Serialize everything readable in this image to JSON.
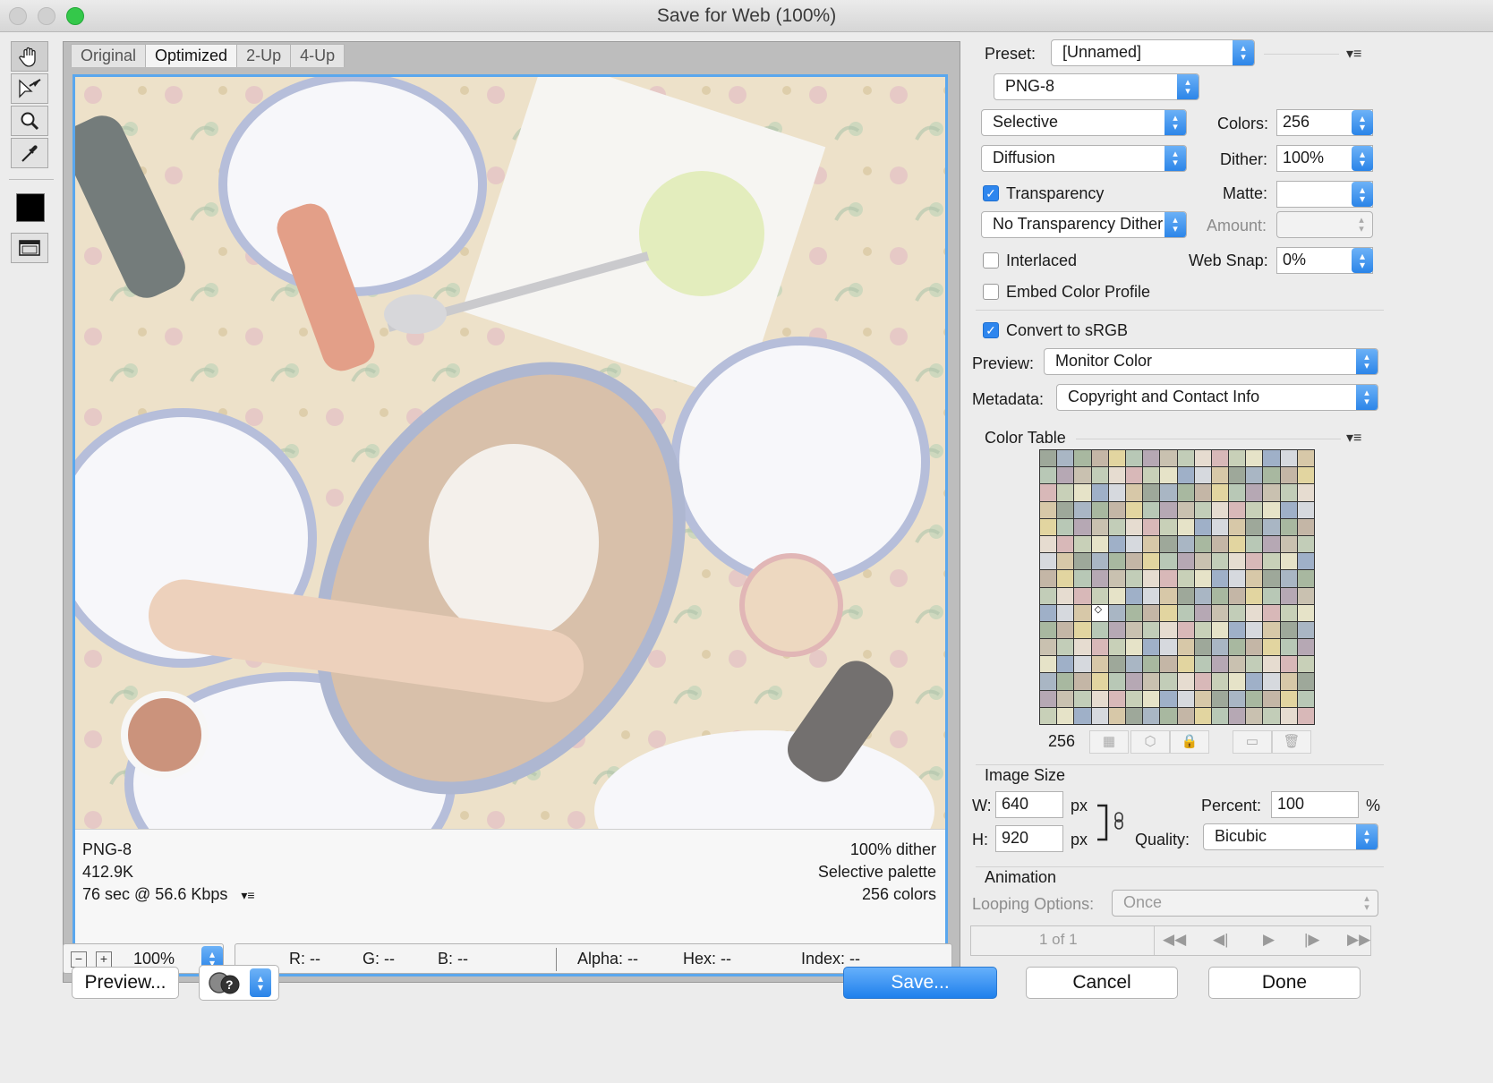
{
  "window": {
    "title": "Save for Web (100%)"
  },
  "tools": [
    {
      "name": "hand-tool",
      "glyph": "✋"
    },
    {
      "name": "slice-select-tool",
      "glyph": "⤡"
    },
    {
      "name": "zoom-tool",
      "glyph": "🔍"
    },
    {
      "name": "eyedropper-tool",
      "glyph": "✎"
    }
  ],
  "viewer": {
    "tabs": [
      "Original",
      "Optimized",
      "2-Up",
      "4-Up"
    ],
    "active_tab": "Optimized",
    "info_left": [
      "PNG-8",
      "412.9K",
      "76 sec @ 56.6 Kbps"
    ],
    "info_right": [
      "100% dither",
      "Selective palette",
      "256 colors"
    ],
    "info_menu_glyph": "▾≡"
  },
  "status": {
    "zoom": "100%",
    "r": "R: --",
    "g": "G: --",
    "b": "B: --",
    "alpha": "Alpha: --",
    "hex": "Hex: --",
    "index": "Index: --"
  },
  "buttons": {
    "preview": "Preview...",
    "save": "Save...",
    "cancel": "Cancel",
    "done": "Done"
  },
  "settings": {
    "preset_label": "Preset:",
    "preset_value": "[Unnamed]",
    "format": "PNG-8",
    "reduction": "Selective",
    "dither_algo": "Diffusion",
    "colors_label": "Colors:",
    "colors_value": "256",
    "dither_label": "Dither:",
    "dither_value": "100%",
    "transparency_label": "Transparency",
    "transparency_checked": true,
    "matte_label": "Matte:",
    "transparency_dither": "No Transparency Dither",
    "amount_label": "Amount:",
    "interlaced_label": "Interlaced",
    "interlaced_checked": false,
    "websnap_label": "Web Snap:",
    "websnap_value": "0%",
    "embed_label": "Embed Color Profile",
    "embed_checked": false,
    "srgb_label": "Convert to sRGB",
    "srgb_checked": true,
    "preview_label": "Preview:",
    "preview_value": "Monitor Color",
    "metadata_label": "Metadata:",
    "metadata_value": "Copyright and Contact Info"
  },
  "color_table": {
    "title": "Color Table",
    "count": "256",
    "palette": [
      "#9ea89a",
      "#c9c1b0",
      "#d6d9de",
      "#b8c8b6",
      "#e6e3c8",
      "#c4b6a6",
      "#d8b8b8",
      "#a9b6c4",
      "#c2cdb8",
      "#d7c8a8",
      "#b6a8b4",
      "#9fb0c8",
      "#e2d5a0",
      "#c8d0b8",
      "#a8b8a0",
      "#e6dcd0"
    ],
    "selected_index": 147
  },
  "image_size": {
    "title": "Image Size",
    "w_label": "W:",
    "w_value": "640",
    "w_unit": "px",
    "h_label": "H:",
    "h_value": "920",
    "h_unit": "px",
    "percent_label": "Percent:",
    "percent_value": "100",
    "percent_unit": "%",
    "quality_label": "Quality:",
    "quality_value": "Bicubic"
  },
  "animation": {
    "title": "Animation",
    "looping_label": "Looping Options:",
    "looping_value": "Once",
    "frame": "1 of 1"
  }
}
